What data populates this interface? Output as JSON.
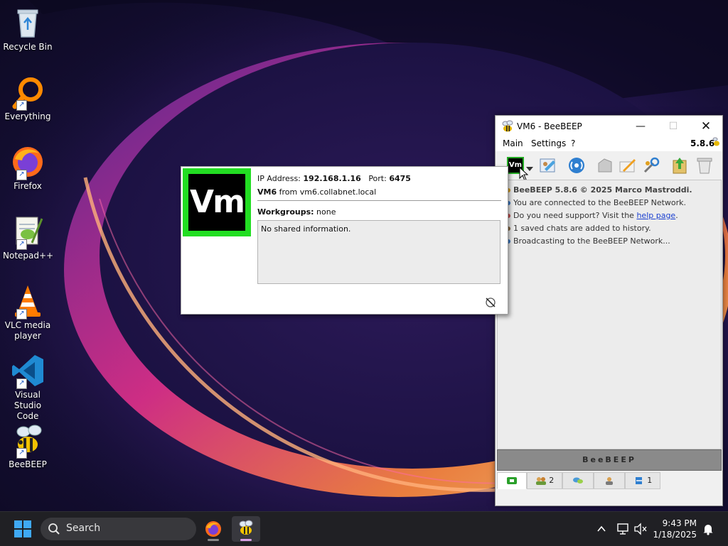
{
  "desktop": {
    "icons": [
      {
        "label": "Recycle Bin"
      },
      {
        "label": "Everything"
      },
      {
        "label": "Firefox"
      },
      {
        "label": "Notepad++"
      },
      {
        "label_line1": "VLC media",
        "label_line2": "player"
      },
      {
        "label_line1": "Visual Studio",
        "label_line2": "Code"
      },
      {
        "label": "BeeBEEP"
      }
    ]
  },
  "beebeep": {
    "title": "VM6 - BeeBEEP",
    "version": "5.8.6",
    "menu": {
      "main": "Main",
      "settings": "Settings",
      "help": "?"
    },
    "toolbar": {
      "avatar_text": "Vm"
    },
    "log": {
      "line1": "BeeBEEP 5.8.6 © 2025 Marco Mastroddi.",
      "line2": "You are connected to the BeeBEEP Network.",
      "line3_prefix": "Do you need support? Visit the ",
      "line3_link": "help page",
      "line3_suffix": ".",
      "line4": "1 saved chats are added to history.",
      "line5": "Broadcasting to the BeeBEEP Network..."
    },
    "banner": "BeeBEEP",
    "tabs": {
      "users_count": "2",
      "files_count": "1"
    }
  },
  "popup": {
    "avatar_text": "Vm",
    "ip_label": "IP Address:",
    "ip_value": "192.168.1.16",
    "port_label": "Port:",
    "port_value": "6475",
    "user_name": "VM6",
    "from_text": "from vm6.collabnet.local",
    "workgroups_label": "Workgroups:",
    "workgroups_value": "none",
    "shared_info": "No shared information."
  },
  "taskbar": {
    "search_label": "Search",
    "time": "9:43 PM",
    "date": "1/18/2025"
  }
}
